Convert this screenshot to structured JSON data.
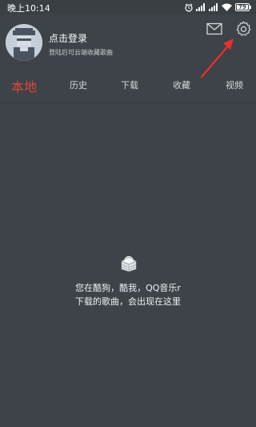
{
  "status_bar": {
    "time": "晚上10:14",
    "battery": "79"
  },
  "header": {
    "login_title": "点击登录",
    "login_subtitle": "登陆后可云端收藏歌曲"
  },
  "tabs": [
    {
      "label": "本地",
      "active": true
    },
    {
      "label": "历史",
      "active": false
    },
    {
      "label": "下载",
      "active": false
    },
    {
      "label": "收藏",
      "active": false
    },
    {
      "label": "视频",
      "active": false
    }
  ],
  "empty_state": {
    "line1": "您在酷狗，酷我，QQ音乐r",
    "line2": "下载的歌曲，会出现在这里"
  },
  "colors": {
    "background": "#3d4348",
    "accent": "#e0463d",
    "annotation_arrow": "#e8302a"
  },
  "icons": [
    "alarm-icon",
    "signal-icon",
    "wifi-icon",
    "battery-icon",
    "mail-icon",
    "gear-icon",
    "basket-icon"
  ]
}
